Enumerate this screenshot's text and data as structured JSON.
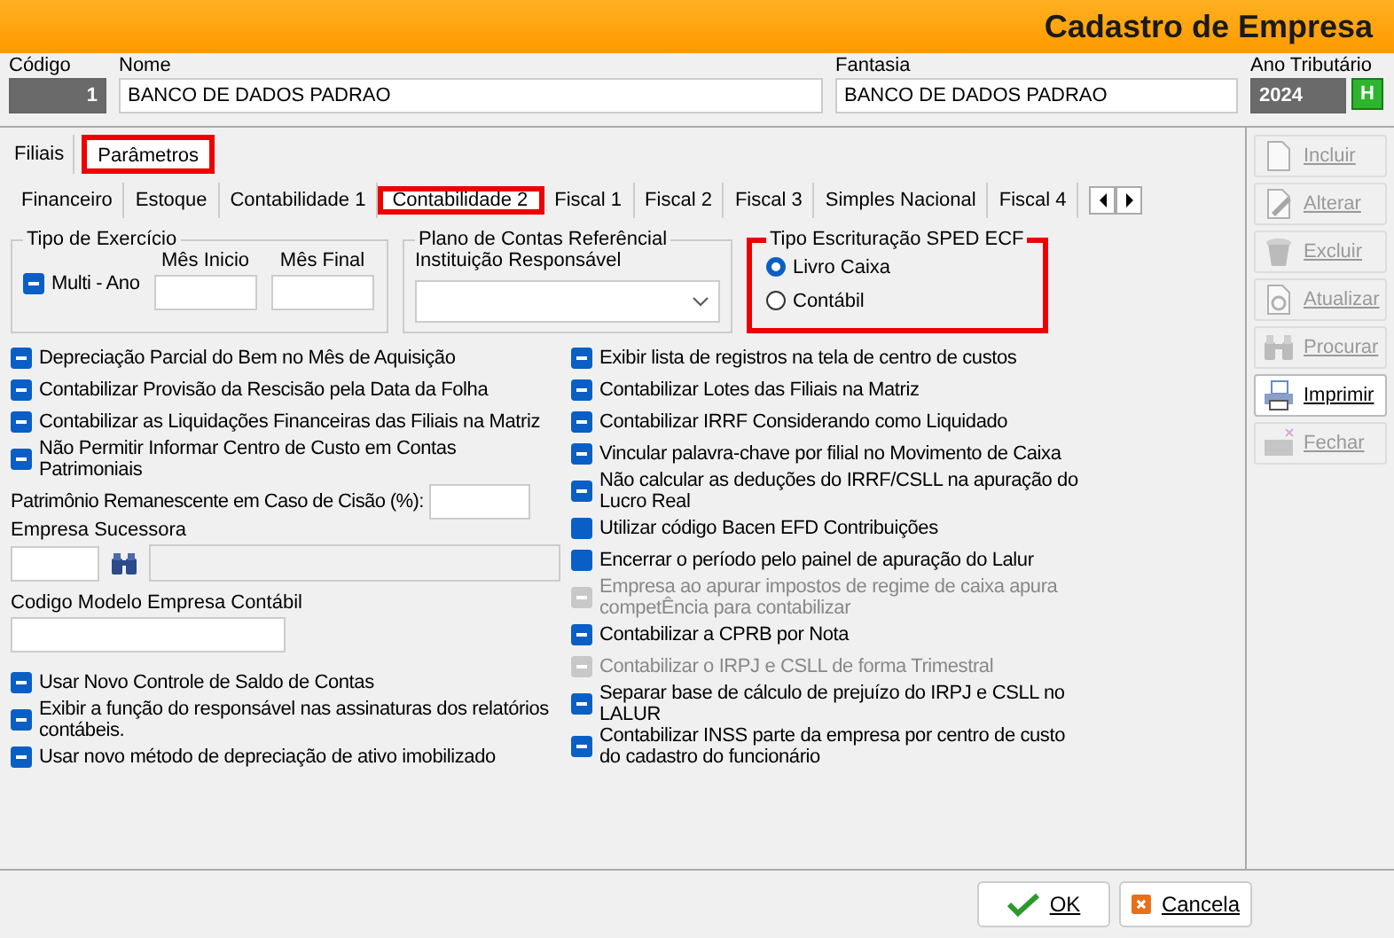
{
  "window": {
    "title": "Cadastro de Empresa"
  },
  "header": {
    "codigo": {
      "label": "Código",
      "value": "1"
    },
    "nome": {
      "label": "Nome",
      "value": "BANCO DE DADOS PADRAO"
    },
    "fantasia": {
      "label": "Fantasia",
      "value": "BANCO DE DADOS PADRAO"
    },
    "ano": {
      "label": "Ano Tributário",
      "value": "2024",
      "button": "H"
    }
  },
  "tabs": [
    {
      "label": "Filiais",
      "selected": false,
      "highlighted": false
    },
    {
      "label": "Parâmetros",
      "selected": true,
      "highlighted": true
    }
  ],
  "subtabs": [
    {
      "label": "Financeiro",
      "selected": false,
      "highlighted": false
    },
    {
      "label": "Estoque",
      "selected": false,
      "highlighted": false
    },
    {
      "label": "Contabilidade 1",
      "selected": false,
      "highlighted": false
    },
    {
      "label": "Contabilidade 2",
      "selected": true,
      "highlighted": true
    },
    {
      "label": "Fiscal 1",
      "selected": false,
      "highlighted": false
    },
    {
      "label": "Fiscal 2",
      "selected": false,
      "highlighted": false
    },
    {
      "label": "Fiscal 3",
      "selected": false,
      "highlighted": false
    },
    {
      "label": "Simples Nacional",
      "selected": false,
      "highlighted": false
    },
    {
      "label": "Fiscal 4",
      "selected": false,
      "highlighted": false
    }
  ],
  "tipo_exercicio": {
    "title": "Tipo de Exercício",
    "multi_ano": {
      "label": "Multi - Ano",
      "indeterminate": true,
      "disabled": false
    },
    "mes_inicio": {
      "label": "Mês Inicio"
    },
    "mes_final": {
      "label": "Mês Final"
    }
  },
  "plano_contas": {
    "title": "Plano de Contas Referêncial",
    "label": "Instituição Responsável"
  },
  "sped_ecf": {
    "title": "Tipo Escrituração SPED ECF",
    "highlighted": true,
    "options": [
      {
        "label": "Livro Caixa",
        "selected": true
      },
      {
        "label": "Contábil",
        "selected": false
      }
    ]
  },
  "options_left": [
    {
      "label": "Depreciação Parcial do Bem no Mês de Aquisição",
      "indeterminate": true,
      "disabled": false
    },
    {
      "label": "Contabilizar Provisão da Rescisão pela Data da Folha",
      "indeterminate": true,
      "disabled": false
    },
    {
      "label": "Contabilizar as Liquidações Financeiras das Filiais na Matriz",
      "indeterminate": true,
      "disabled": false
    },
    {
      "label": "Não Permitir Informar Centro de Custo em Contas Patrimoniais",
      "indeterminate": true,
      "disabled": false
    }
  ],
  "patrimonio": {
    "label": "Patrimônio Remanescente em Caso de Cisão (%):"
  },
  "empresa_sucessora": {
    "label": "Empresa Sucessora"
  },
  "codigo_modelo": {
    "label": "Codigo Modelo Empresa Contábil"
  },
  "options_left_bottom": [
    {
      "label": "Usar Novo Controle de Saldo de Contas",
      "indeterminate": true,
      "disabled": false
    },
    {
      "label": "Exibir a função do responsável nas assinaturas dos relatórios contábeis.",
      "indeterminate": true,
      "disabled": false
    },
    {
      "label": "Usar novo método de depreciação de ativo imobilizado",
      "indeterminate": true,
      "disabled": false
    }
  ],
  "options_right": [
    {
      "label": "Exibir lista de registros na tela de centro de custos",
      "indeterminate": true,
      "disabled": false
    },
    {
      "label": "Contabilizar Lotes das Filiais na Matriz",
      "indeterminate": true,
      "disabled": false
    },
    {
      "label": "Contabilizar IRRF Considerando como Liquidado",
      "indeterminate": true,
      "disabled": false
    },
    {
      "label": "Vincular palavra-chave por filial no Movimento de Caixa",
      "indeterminate": true,
      "disabled": false
    },
    {
      "label": "Não calcular as deduções do IRRF/CSLL na apuração do Lucro Real",
      "indeterminate": true,
      "disabled": false
    },
    {
      "label": "Utilizar código Bacen EFD Contribuições",
      "indeterminate": false,
      "disabled": false
    },
    {
      "label": "Encerrar o período pelo painel de apuração do Lalur",
      "indeterminate": false,
      "disabled": false
    },
    {
      "label": "Empresa ao apurar impostos de regime de caixa apura competÊncia para contabilizar",
      "indeterminate": true,
      "disabled": true
    },
    {
      "label": "Contabilizar a CPRB por Nota",
      "indeterminate": true,
      "disabled": false
    },
    {
      "label": "Contabilizar o IRPJ e CSLL de forma Trimestral",
      "indeterminate": true,
      "disabled": true
    },
    {
      "label": "Separar base de cálculo de prejuízo do IRPJ e CSLL no LALUR",
      "indeterminate": true,
      "disabled": false
    },
    {
      "label": "Contabilizar INSS parte da empresa por centro de custo do cadastro do funcionário",
      "indeterminate": true,
      "disabled": false
    }
  ],
  "side_buttons": [
    {
      "label": "Incluir",
      "kind": "page",
      "disabled": true
    },
    {
      "label": "Alterar",
      "kind": "edit",
      "disabled": true
    },
    {
      "label": "Excluir",
      "kind": "trash",
      "disabled": true
    },
    {
      "label": "Atualizar",
      "kind": "refresh",
      "disabled": true
    },
    {
      "label": "Procurar",
      "kind": "binoculars",
      "disabled": true
    },
    {
      "label": "Imprimir",
      "kind": "printer",
      "disabled": false
    },
    {
      "label": "Fechar",
      "kind": "close",
      "disabled": true
    }
  ],
  "footer_buttons": [
    {
      "label": "OK",
      "kind": "ok"
    },
    {
      "label": "Cancela",
      "kind": "cancel"
    }
  ]
}
